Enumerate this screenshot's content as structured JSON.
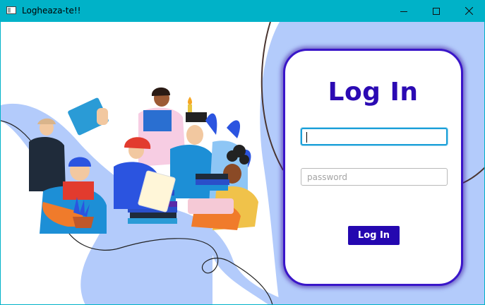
{
  "window": {
    "title": "Logheaza-te!!",
    "controls": {
      "minimize_icon": "minimize-icon",
      "maximize_icon": "maximize-icon",
      "close_icon": "close-icon"
    }
  },
  "login": {
    "heading": "Log In",
    "username_value": "",
    "username_placeholder": "",
    "password_placeholder": "password",
    "button_label": "Log In"
  },
  "colors": {
    "titlebar": "#00b2c8",
    "accent": "#2b0ab3",
    "button": "#2407b0",
    "blob": "#b3cbfb",
    "focus": "#1a9fd8"
  },
  "illustration": {
    "subject": "people-reading-books-illustration"
  }
}
